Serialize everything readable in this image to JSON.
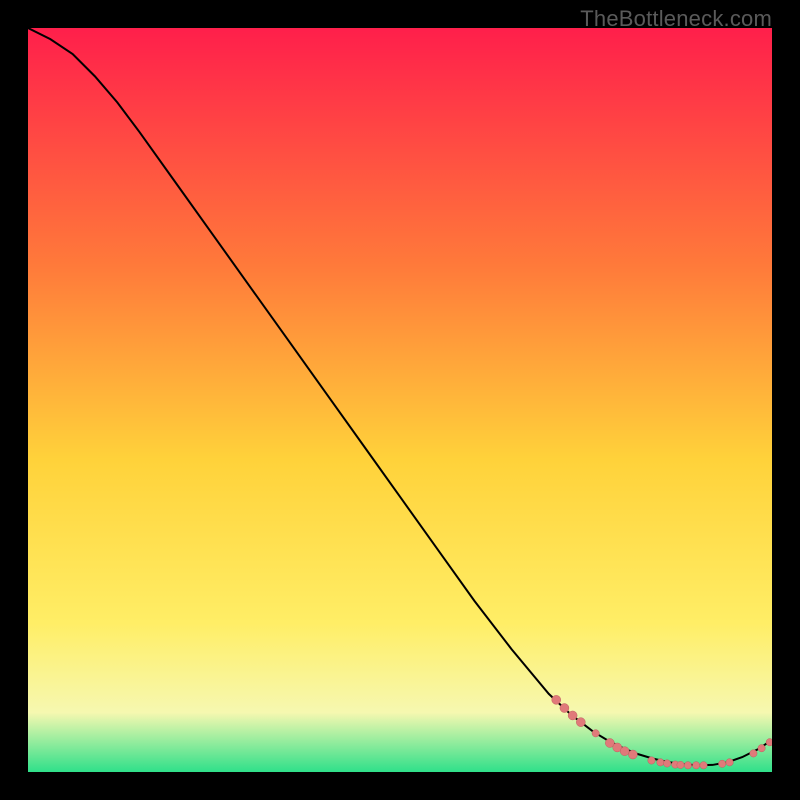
{
  "attribution": "TheBottleneck.com",
  "colors": {
    "gradient_top": "#ff1f4b",
    "gradient_mid_upper": "#ff7a3a",
    "gradient_mid": "#ffd23a",
    "gradient_mid_lower": "#ffee66",
    "gradient_low_yellow": "#f6f8b0",
    "gradient_green": "#2fe08a",
    "curve": "#000000",
    "marker_fill": "#e07a7a",
    "marker_stroke": "#c06060",
    "background": "#000000"
  },
  "chart_data": {
    "type": "line",
    "title": "",
    "xlabel": "",
    "ylabel": "",
    "xlim": [
      0,
      100
    ],
    "ylim": [
      0,
      100
    ],
    "note": "Axes are unlabeled; values below are positions read off the plot as % of axis range (0 = left/bottom, 100 = right/top).",
    "series": [
      {
        "name": "curve",
        "x": [
          0,
          3,
          6,
          9,
          12,
          15,
          20,
          25,
          30,
          35,
          40,
          45,
          50,
          55,
          60,
          65,
          70,
          73,
          76,
          78,
          80,
          82,
          84,
          86,
          88,
          90,
          92,
          94,
          96,
          98,
          100
        ],
        "y": [
          100,
          98.5,
          96.5,
          93.5,
          90,
          86,
          79,
          72,
          65,
          58,
          51,
          44,
          37,
          30,
          23,
          16.5,
          10.5,
          7.7,
          5.4,
          4.2,
          3.2,
          2.4,
          1.8,
          1.35,
          1.05,
          0.9,
          0.95,
          1.3,
          2.0,
          3.0,
          4.3
        ]
      }
    ],
    "markers": {
      "name": "highlighted-points",
      "comment": "Clusters of emphasised points along the curve near the lower-right.",
      "points": [
        {
          "x": 71.0,
          "y": 9.7,
          "r": 1.1
        },
        {
          "x": 72.1,
          "y": 8.6,
          "r": 1.1
        },
        {
          "x": 73.2,
          "y": 7.6,
          "r": 1.1
        },
        {
          "x": 74.3,
          "y": 6.7,
          "r": 1.1
        },
        {
          "x": 76.3,
          "y": 5.2,
          "r": 0.9
        },
        {
          "x": 78.2,
          "y": 3.9,
          "r": 1.1
        },
        {
          "x": 79.2,
          "y": 3.3,
          "r": 1.1
        },
        {
          "x": 80.2,
          "y": 2.8,
          "r": 1.1
        },
        {
          "x": 81.3,
          "y": 2.35,
          "r": 1.1
        },
        {
          "x": 83.8,
          "y": 1.55,
          "r": 0.9
        },
        {
          "x": 85.0,
          "y": 1.3,
          "r": 0.9
        },
        {
          "x": 85.9,
          "y": 1.15,
          "r": 0.9
        },
        {
          "x": 87.0,
          "y": 1.0,
          "r": 0.9
        },
        {
          "x": 87.7,
          "y": 0.95,
          "r": 0.9
        },
        {
          "x": 88.7,
          "y": 0.9,
          "r": 0.9
        },
        {
          "x": 89.8,
          "y": 0.9,
          "r": 0.9
        },
        {
          "x": 90.8,
          "y": 0.9,
          "r": 0.9
        },
        {
          "x": 93.3,
          "y": 1.1,
          "r": 0.9
        },
        {
          "x": 94.3,
          "y": 1.3,
          "r": 0.9
        },
        {
          "x": 97.5,
          "y": 2.5,
          "r": 0.9
        },
        {
          "x": 98.6,
          "y": 3.2,
          "r": 0.9
        },
        {
          "x": 99.7,
          "y": 4.0,
          "r": 0.9
        }
      ]
    }
  }
}
